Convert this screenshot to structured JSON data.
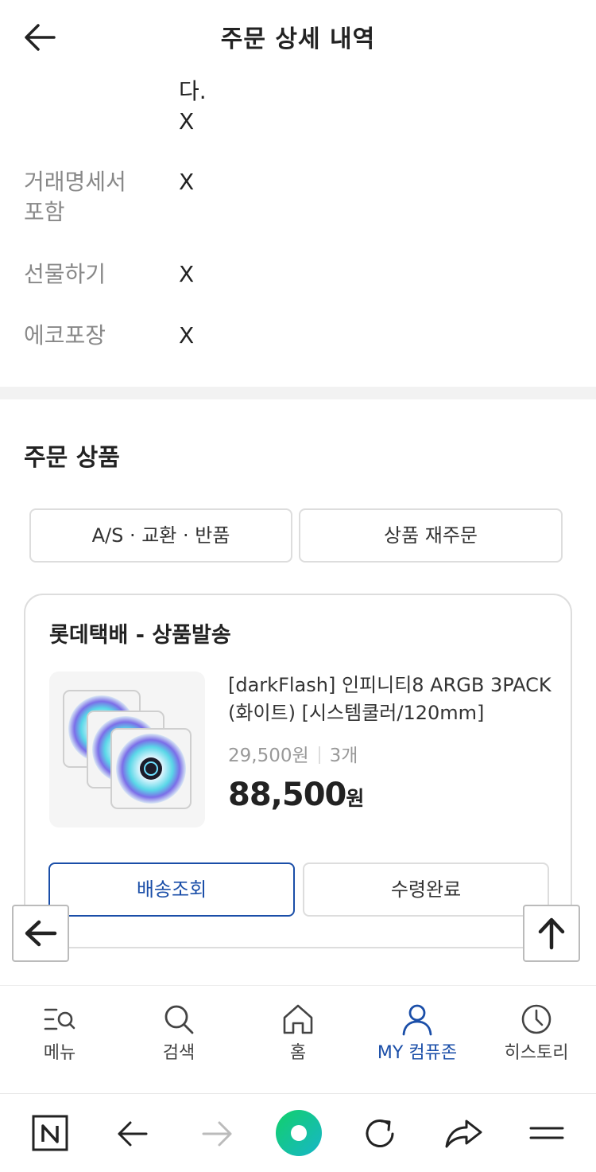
{
  "header": {
    "title": "주문 상세 내역"
  },
  "info": {
    "partial_row_value_line1": "다.",
    "partial_row_value_line2": "X",
    "rows": [
      {
        "label_line1": "거래명세서",
        "label_line2": "포함",
        "value": "X"
      },
      {
        "label_line1": "선물하기",
        "label_line2": "",
        "value": "X"
      },
      {
        "label_line1": "에코포장",
        "label_line2": "",
        "value": "X"
      }
    ]
  },
  "order_products": {
    "section_title": "주문 상품",
    "as_button": "A/S · 교환 · 반품",
    "reorder_button": "상품 재주문",
    "card": {
      "carrier": "롯데택배 - 상품발송",
      "product_name": "[darkFlash] 인피니티8 ARGB 3PACK (화이트) [시스템쿨러/120mm]",
      "unit_price": "29,500원",
      "quantity": "3개",
      "total_price": "88,500",
      "total_price_unit": "원",
      "track_button": "배송조회",
      "received_button": "수령완료"
    }
  },
  "bottom_nav": {
    "items": [
      {
        "label": "메뉴",
        "icon": "menu-search-icon",
        "active": false
      },
      {
        "label": "검색",
        "icon": "search-icon",
        "active": false
      },
      {
        "label": "홈",
        "icon": "home-icon",
        "active": false
      },
      {
        "label": "MY 컴퓨존",
        "icon": "user-icon",
        "active": true
      },
      {
        "label": "히스토리",
        "icon": "clock-icon",
        "active": false
      }
    ]
  },
  "browser_toolbar": {
    "items": [
      "naver-n-icon",
      "back-arrow-icon",
      "forward-arrow-icon",
      "green-circle-home-icon",
      "refresh-icon",
      "share-icon",
      "hamburger-menu-icon"
    ]
  },
  "colors": {
    "accent": "#1a4ea8",
    "divider": "#f2f2f2",
    "green": "#03c75a"
  }
}
